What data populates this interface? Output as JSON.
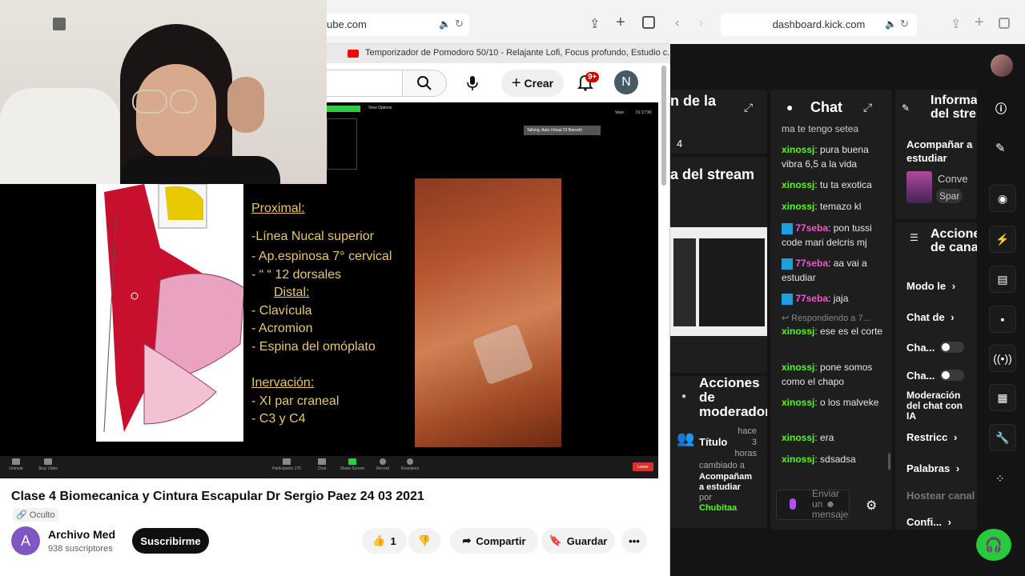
{
  "youtube": {
    "url": "ube.com",
    "tab_title": "Temporizador de Pomodoro 50/10 - Relajante Lofi, Focus profundo, Estudio c...",
    "create_label": "Crear",
    "notif_count": "9+",
    "avatar_letter": "N",
    "video_title": "Clase 4 Biomecanica y Cintura Escapular Dr Sergio Paez 24 03 2021",
    "visibility": "Oculto",
    "channel_name": "Archivo Med",
    "channel_letter": "A",
    "subscribers": "938 suscriptores",
    "subscribe_label": "Suscribirme",
    "like_count": "1",
    "share_label": "Compartir",
    "save_label": "Guardar"
  },
  "slide": {
    "proximal_head": "Proximal:",
    "p1": "-Línea Nucal superior",
    "p2": "- Ap.espinosa 7° cervical",
    "p3": "- “      “       12 dorsales",
    "distal_head": "Distal:",
    "d1": "- Clavícula",
    "d2": "- Acromion",
    "d3": "- Espina del omóplato",
    "inerv_head": "Inervación:",
    "i1": "- XI par craneal",
    "i2": "- C3 y C4"
  },
  "zoom": {
    "talking": "Talking: Aula Virtual 22 Barceló",
    "view": "View",
    "options": "View Options",
    "time": "01:17:30",
    "buttons": [
      "Unmute",
      "Stop Video",
      "Participants",
      "Chat",
      "Share Screen",
      "Record",
      "Reactions"
    ],
    "participants": "175",
    "leave": "Leave"
  },
  "kick": {
    "url": "dashboard.kick.com",
    "panel1_title": "n de la",
    "panel1_value": "4",
    "panel2_title": "a del stream",
    "chat_title": "Chat",
    "chat": [
      {
        "user": "",
        "text": "ma te tengo setea"
      },
      {
        "user": "xinossj",
        "text": "pura buena vibra 6,5 a la vida"
      },
      {
        "user": "xinossj",
        "text": "tu ta exotica"
      },
      {
        "user": "xinossj",
        "text": "temazo kl"
      },
      {
        "user": "77seba",
        "text": "pon tussi code mari delcris mj"
      },
      {
        "user": "77seba",
        "text": "aa vai a estudiar"
      },
      {
        "user": "77seba",
        "text": "jaja"
      },
      {
        "user": "xinossj",
        "text": "ese es el corte"
      },
      {
        "user": "xinossj",
        "text": "pone somos como el chapo"
      },
      {
        "user": "xinossj",
        "text": "o los malveke"
      },
      {
        "user": "xinossj",
        "text": "era"
      },
      {
        "user": "xinossj",
        "text": "sdsadsa"
      }
    ],
    "reply_label": "Respondiendo a 7...",
    "send_placeholder": "Enviar un ☻ mensaje",
    "info_title": "Informa del stre",
    "accompany_label": "Acompañar a estudiar",
    "category_1": "Conve",
    "category_2": "Spar",
    "channel_actions_title": "Accione de cana",
    "actions": [
      "Modo le",
      "Chat de",
      "Cha...",
      "Cha...",
      "Moderación del chat con IA",
      "Restricc",
      "Palabras",
      "Hostear canal",
      "Confi..."
    ],
    "mod_title": "Acciones de moderador",
    "mod_field": "Título",
    "mod_time": "hace 3 horas",
    "mod_change": "cambiado a",
    "mod_value": "Acompañam a estudiar",
    "mod_by": "por",
    "mod_user": "Chubitaa"
  }
}
